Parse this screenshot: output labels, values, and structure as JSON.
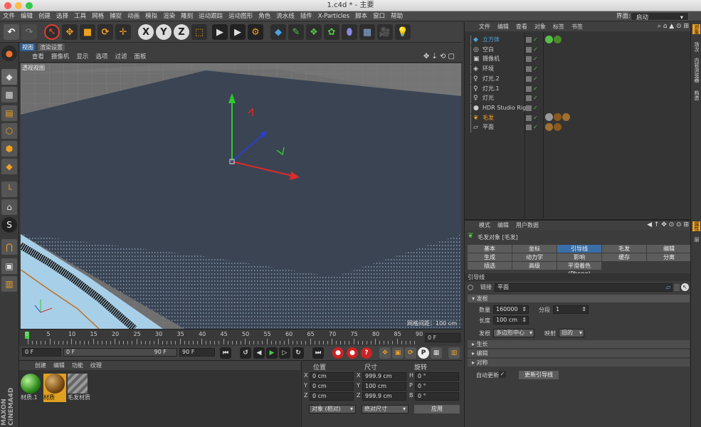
{
  "window": {
    "title": "1.c4d * - 主要"
  },
  "menubar": [
    "文件",
    "编辑",
    "创建",
    "选择",
    "工具",
    "网格",
    "捕捉",
    "动画",
    "模拟",
    "渲染",
    "雕刻",
    "运动跟踪",
    "运动图形",
    "角色",
    "流水线",
    "插件",
    "X-Particles",
    "脚本",
    "窗口",
    "帮助"
  ],
  "layout": {
    "label": "界面:",
    "value": "启动"
  },
  "toolbar": {
    "x": "X",
    "y": "Y",
    "z": "Z"
  },
  "viewport": {
    "tabs": [
      "视图",
      "渲染设置"
    ],
    "menu": [
      "查看",
      "摄像机",
      "显示",
      "选项",
      "过滤",
      "面板"
    ],
    "label": "透视视图",
    "grid_info": "网格间距：100 cm"
  },
  "timeline": {
    "ticks": [
      "0",
      "5",
      "10",
      "15",
      "20",
      "25",
      "30",
      "35",
      "40",
      "45",
      "50",
      "55",
      "60",
      "65",
      "70",
      "75",
      "80",
      "85",
      "90"
    ],
    "current": "0 F"
  },
  "transport": {
    "start": "0 F",
    "range_start": "0 F",
    "range_end": "90 F",
    "end": "90 F"
  },
  "materials": {
    "menu": [
      "创建",
      "编辑",
      "功能",
      "纹理"
    ],
    "items": [
      {
        "name": "材质.1"
      },
      {
        "name": "材质"
      },
      {
        "name": "毛发材质"
      }
    ]
  },
  "coords": {
    "headers": {
      "pos": "位置",
      "size": "尺寸",
      "rot": "旋转"
    },
    "rows": [
      {
        "axis": "X",
        "pos": "0 cm",
        "size_axis": "X",
        "size": "999.9 cm",
        "rot_axis": "H",
        "rot": "0 °"
      },
      {
        "axis": "Y",
        "pos": "0 cm",
        "size_axis": "Y",
        "size": "100 cm",
        "rot_axis": "P",
        "rot": "0 °"
      },
      {
        "axis": "Z",
        "pos": "0 cm",
        "size_axis": "Z",
        "size": "999.9 cm",
        "rot_axis": "B",
        "rot": "0 °"
      }
    ],
    "mode": "对象 (相对)",
    "size_mode": "绝对尺寸",
    "apply": "应用"
  },
  "objects": {
    "menu": [
      "文件",
      "编辑",
      "查看",
      "对象",
      "标签",
      "书签"
    ],
    "items": [
      {
        "name": "立方体",
        "icon": "cube-icon",
        "color": "#4da3e0"
      },
      {
        "name": "空白",
        "icon": "null-icon",
        "color": "#cfcfcf"
      },
      {
        "name": "摄像机",
        "icon": "camera-icon",
        "color": "#cfcfcf"
      },
      {
        "name": "环境",
        "icon": "environment-icon",
        "color": "#cfcfcf"
      },
      {
        "name": "灯光.2",
        "icon": "light-icon",
        "color": "#cfcfcf"
      },
      {
        "name": "灯光.1",
        "icon": "light-icon",
        "color": "#cfcfcf"
      },
      {
        "name": "灯光",
        "icon": "light-icon",
        "color": "#cfcfcf"
      },
      {
        "name": "HDR Studio Rig",
        "icon": "rig-icon",
        "color": "#cfcfcf"
      },
      {
        "name": "毛发",
        "icon": "hair-icon",
        "color": "#f0a020"
      },
      {
        "name": "平面",
        "icon": "plane-icon",
        "color": "#cfcfcf"
      }
    ]
  },
  "attributes": {
    "menu": [
      "模式",
      "编辑",
      "用户数据"
    ],
    "title": "毛发对象 [毛发]",
    "tabs_row1": [
      "基本",
      "坐标",
      "引导线",
      "毛发",
      "编辑"
    ],
    "tabs_row2": [
      "生成",
      "动力学",
      "影响",
      "缓存",
      "分离"
    ],
    "tabs_row3": [
      "插选",
      "高级",
      "平滑着色(Phong)"
    ],
    "section": "引导线",
    "link_label": "链接",
    "link_value": "平面",
    "roots_section": "发根",
    "count_label": "数量",
    "count_value": "160000",
    "segments_label": "分段",
    "segments_value": "1",
    "length_label": "长度",
    "length_value": "100 cm",
    "root_label": "发根",
    "root_value": "多边形中心",
    "mapping_label": "映射",
    "mapping_value": "旧的",
    "growth": "生长",
    "edit": "编辑",
    "symmetry": "对称",
    "auto_update": "自动更新",
    "update_button": "更新引导线"
  },
  "sidetabs": [
    "对象",
    "场次",
    "内容浏览器",
    "构造"
  ],
  "sidetabs_attr": [
    "属性",
    "层"
  ]
}
